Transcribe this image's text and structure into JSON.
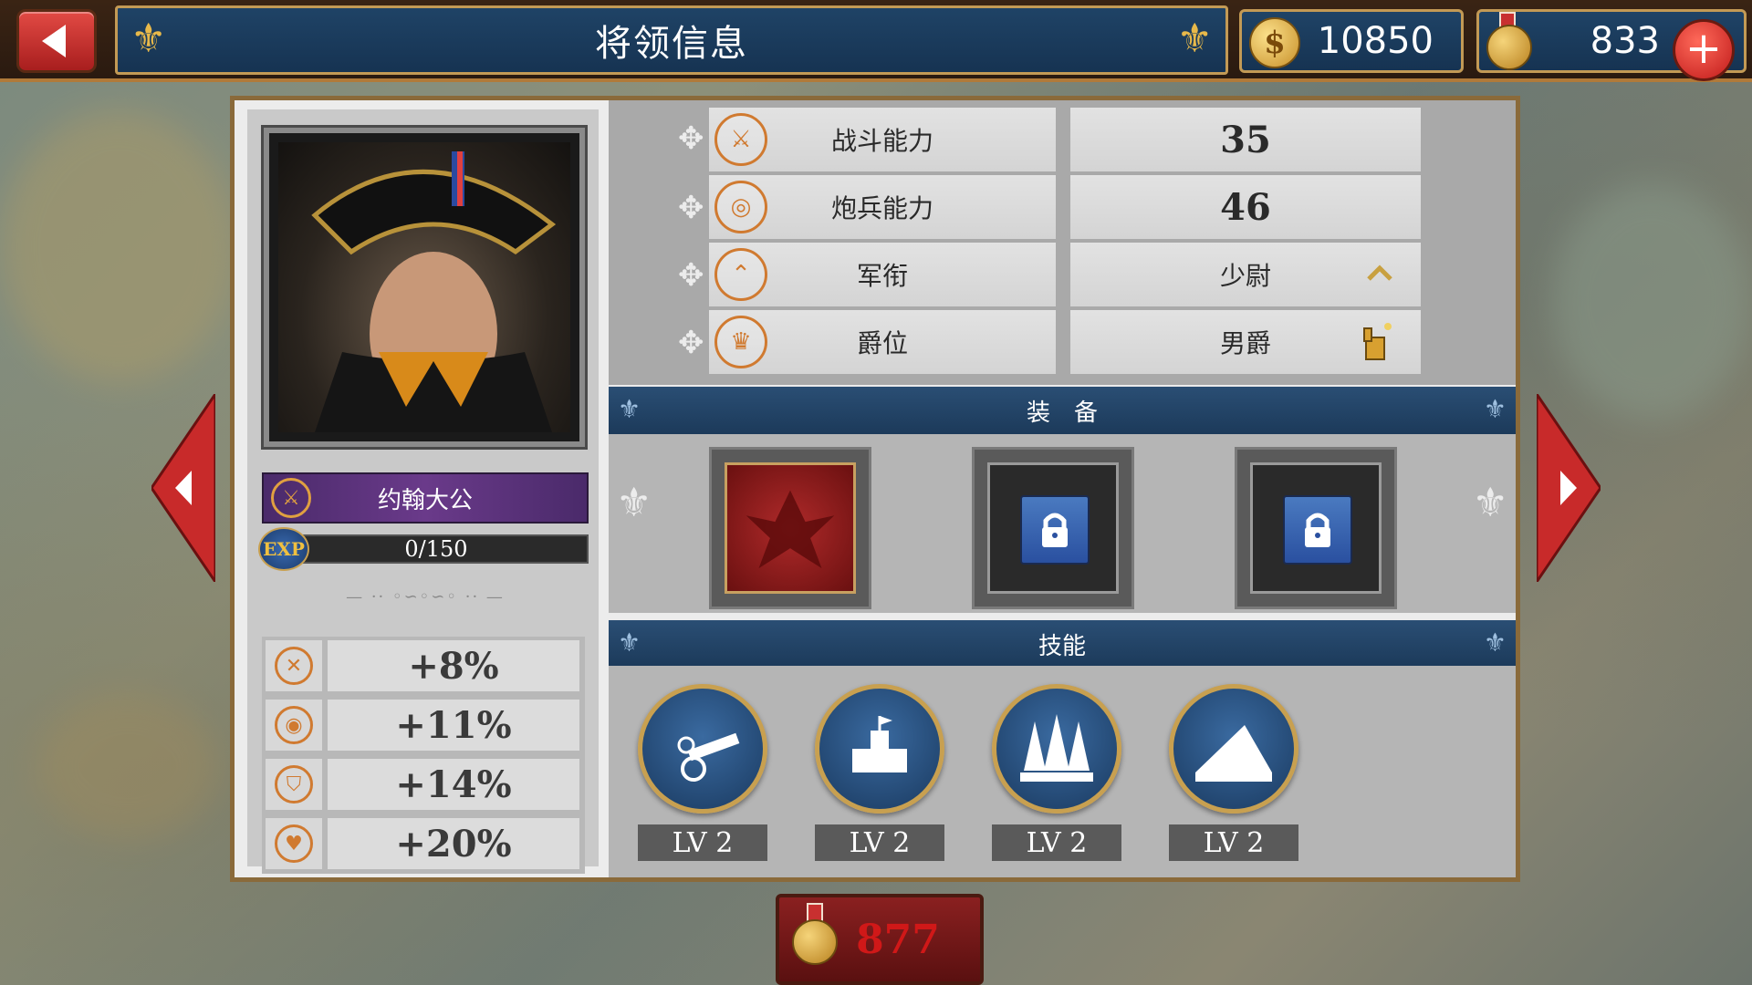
{
  "header": {
    "back_label": "",
    "title": "将领信息",
    "gold": "10850",
    "medals": "833",
    "add_label": "+"
  },
  "general": {
    "name": "约翰大公",
    "exp_label": "EXP",
    "exp_text": "0/150",
    "exp_progress": 0.0
  },
  "bonuses": [
    {
      "icon": "swords-plus-icon",
      "value": "+8%"
    },
    {
      "icon": "cannon-plus-icon",
      "value": "+11%"
    },
    {
      "icon": "shield-plus-icon",
      "value": "+14%"
    },
    {
      "icon": "heart-plus-icon",
      "value": "+20%"
    }
  ],
  "stats": [
    {
      "icon": "crossed-swords-icon",
      "label": "战斗能力",
      "value": "35"
    },
    {
      "icon": "cannon-icon",
      "label": "炮兵能力",
      "value": "46"
    },
    {
      "icon": "chevron-rank-icon",
      "label": "军衔",
      "value": "少尉"
    },
    {
      "icon": "crown-icon",
      "label": "爵位",
      "value": "男爵"
    }
  ],
  "equipment": {
    "title": "装　备",
    "slots": [
      {
        "state": "equipped",
        "icon": "eagle-emblem-icon"
      },
      {
        "state": "locked",
        "icon": "lock-icon"
      },
      {
        "state": "locked",
        "icon": "lock-icon"
      }
    ]
  },
  "skills": {
    "title": "技能",
    "items": [
      {
        "icon": "artillery-skill-icon",
        "level": "LV 2"
      },
      {
        "icon": "fortress-skill-icon",
        "level": "LV 2"
      },
      {
        "icon": "bayonet-wall-skill-icon",
        "level": "LV 2"
      },
      {
        "icon": "mountain-skill-icon",
        "level": "LV 2"
      }
    ]
  },
  "footer": {
    "medal_cost": "877"
  },
  "colors": {
    "accent_gold": "#c39a55",
    "title_blue": "#1f4366",
    "orange_icon": "#d07a30",
    "cost_red": "#d01818"
  }
}
